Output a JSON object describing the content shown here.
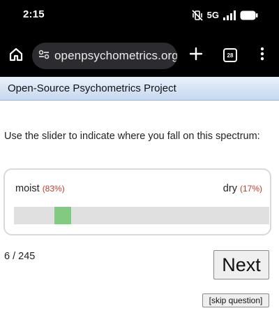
{
  "status_bar": {
    "time": "2:15",
    "network_label": "5G",
    "icons": [
      "vibrate-mute-icon",
      "5g-signal-icon",
      "battery-icon"
    ]
  },
  "browser": {
    "url": "openpsychometrics.org/",
    "tab_count": "28",
    "icons": [
      "home-icon",
      "site-settings-icon",
      "new-tab-plus-icon",
      "tab-switcher-icon",
      "more-menu-icon"
    ]
  },
  "site": {
    "title": "Open-Source Psychometrics Project"
  },
  "question": {
    "prompt": "Use the slider to indicate where you fall on this spectrum:",
    "left_pole": "moist",
    "left_percent": "(83%)",
    "right_pole": "dry",
    "right_percent": "(17%)",
    "slider_value_fraction": 0.17
  },
  "navigation": {
    "progress": "6 / 245",
    "next_label": "Next",
    "skip_label": "[skip question]"
  },
  "colors": {
    "header_gradient_top": "#eaf1fb",
    "header_gradient_bottom": "#c6d8ef",
    "slider_thumb": "#82c982",
    "slider_track": "#e0e0e0",
    "percent_text": "#c0392b"
  }
}
